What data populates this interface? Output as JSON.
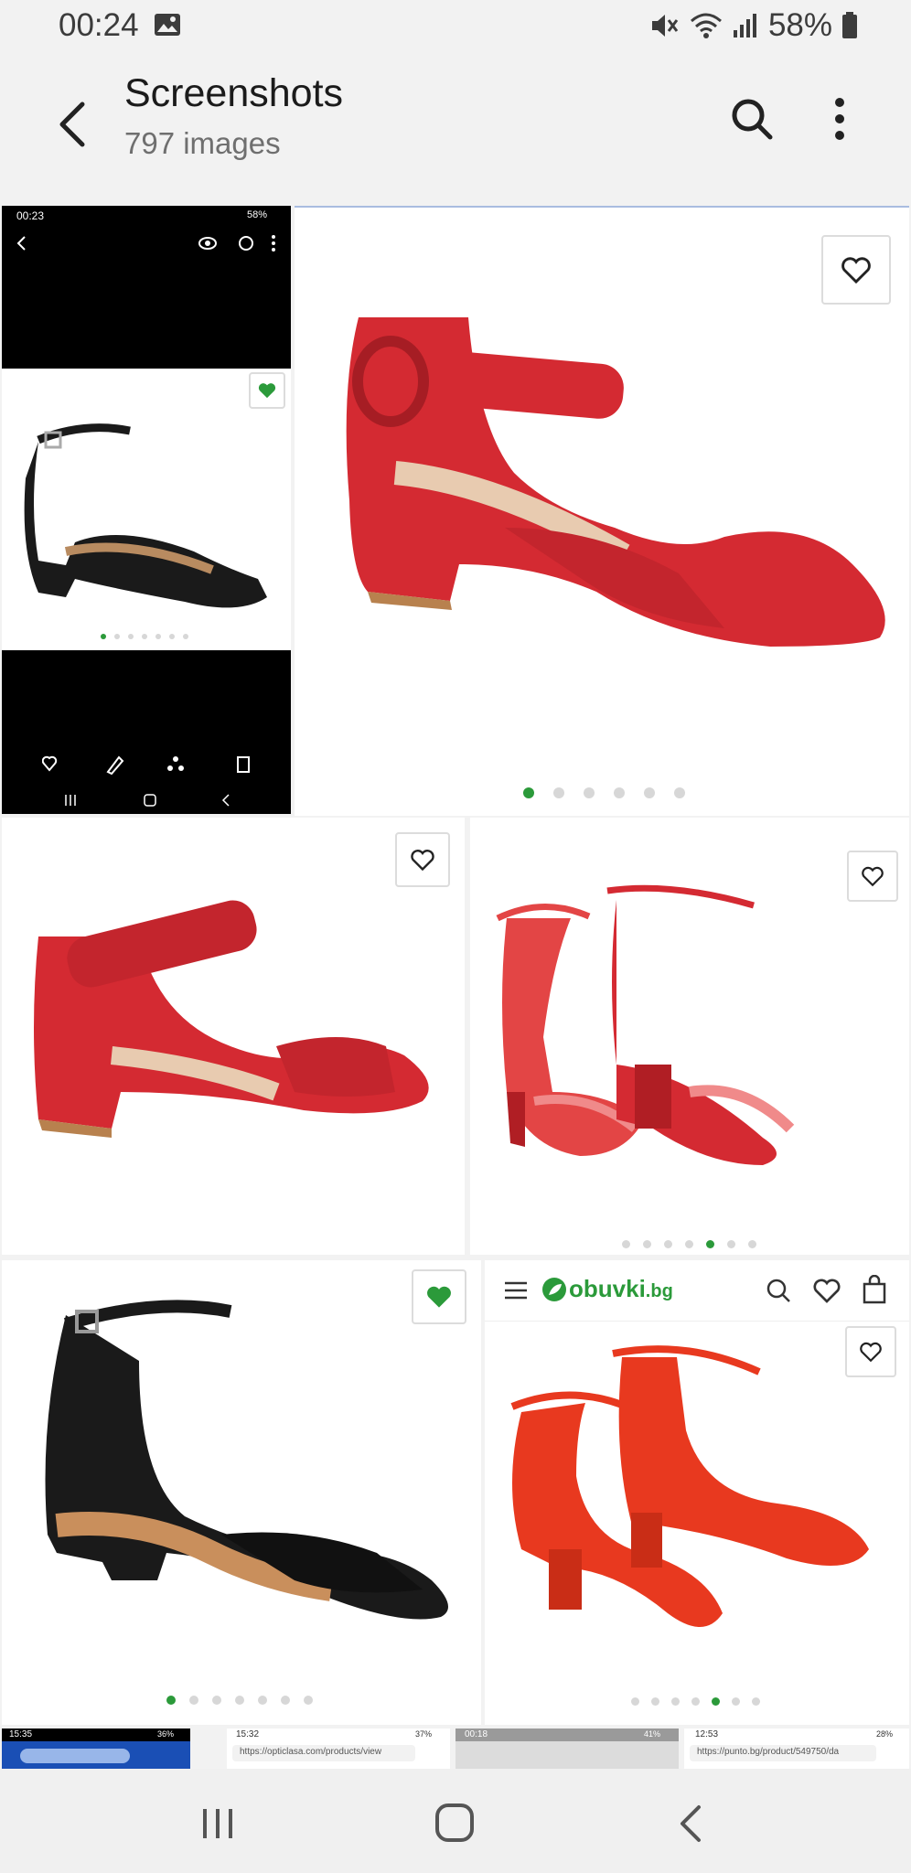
{
  "status_bar": {
    "time": "00:24",
    "battery": "58%"
  },
  "header": {
    "title": "Screenshots",
    "subtitle": "797 images"
  },
  "tiles": [
    {
      "kind": "phone_screenshot",
      "time": "00:23",
      "battery": "58%",
      "favorited": true,
      "dots_total": 7,
      "dots_active": 0
    },
    {
      "kind": "shoe",
      "name": "red-suede-sandal-large",
      "favorited": false,
      "dots_total": 6,
      "dots_active": 0
    },
    {
      "kind": "shoe",
      "name": "red-suede-sandal",
      "favorited": false
    },
    {
      "kind": "shoe",
      "name": "red-patent-sandals-pair",
      "favorited": false,
      "dots_total": 7,
      "dots_active": 4
    },
    {
      "kind": "shoe",
      "name": "black-leather-sandal",
      "favorited": true,
      "dots_total": 7,
      "dots_active": 0
    },
    {
      "kind": "shoe",
      "name": "orange-suede-sandals-pair",
      "favorited": false,
      "dots_total": 7,
      "dots_active": 4
    }
  ],
  "obuvki": {
    "brand_prefix": "obuvki",
    "brand_suffix": ".bg"
  },
  "thumb_strip": [
    {
      "time": "15:35",
      "status": "36%"
    },
    {
      "time": "15:32",
      "status": "37%",
      "url": "https://opticlasa.com/products/view"
    },
    {
      "time": "00:18",
      "status": "41%"
    },
    {
      "time": "12:53",
      "status": "28%",
      "url": "https://punto.bg/product/549750/da"
    }
  ],
  "colors": {
    "accent_green": "#2b9a3a",
    "red": "#d42a32",
    "orange_red": "#e8391f",
    "black_shoe": "#1a1a1a"
  }
}
